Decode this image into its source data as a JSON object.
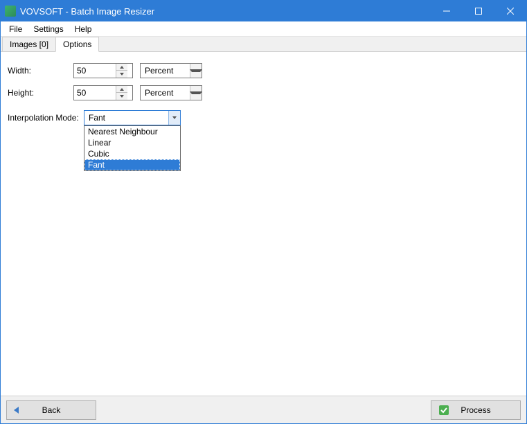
{
  "window": {
    "title": "VOVSOFT - Batch Image Resizer"
  },
  "menubar": {
    "file": "File",
    "settings": "Settings",
    "help": "Help"
  },
  "tabs": {
    "images": "Images [0]",
    "options": "Options"
  },
  "options": {
    "width_label": "Width:",
    "width_value": "50",
    "width_unit": "Percent",
    "height_label": "Height:",
    "height_value": "50",
    "height_unit": "Percent",
    "interpolation_label": "Interpolation Mode:",
    "interpolation_value": "Fant",
    "interpolation_options": {
      "o0": "Nearest Neighbour",
      "o1": "Linear",
      "o2": "Cubic",
      "o3": "Fant"
    }
  },
  "footer": {
    "back": "Back",
    "process": "Process"
  }
}
